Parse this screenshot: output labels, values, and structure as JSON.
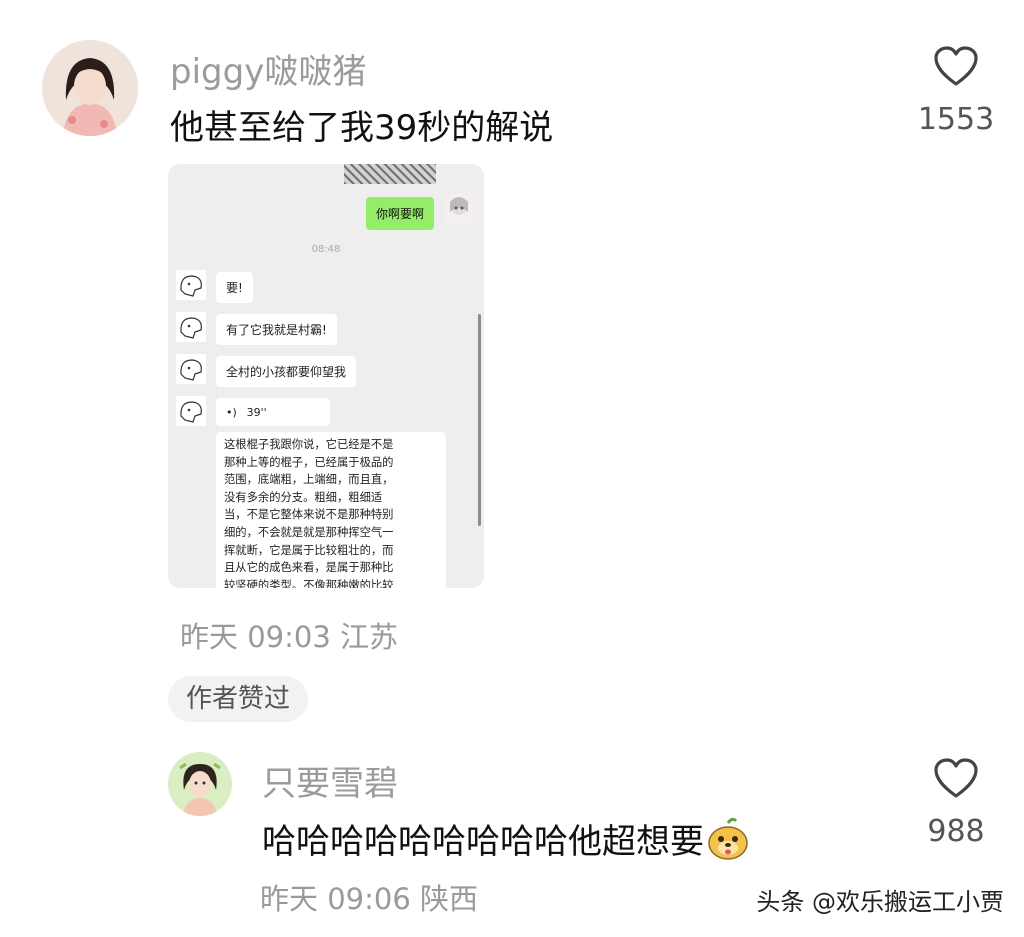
{
  "comments": [
    {
      "username": "piggy啵啵猪",
      "text": "他甚至给了我39秒的解说",
      "likes": "1553",
      "time_location": "昨天 09:03 江苏",
      "badge": "作者赞过",
      "attachment": {
        "sent_message": "你啊要啊",
        "chat_time": "08:48",
        "received_messages": [
          "要!",
          "有了它我就是村霸!",
          "全村的小孩都要仰望我"
        ],
        "voice_duration": "39''",
        "voice_icon": "voice-wave-icon",
        "transcript_lines": [
          "这根棍子我跟你说，它已经是不是",
          "那种上等的棍子，已经属于极品的",
          "范围，底端粗，上端细，而且直，",
          "没有多余的分支。粗细，粗细适",
          "当，不是它整体来说不是那种特别",
          "细的，不会就是就是那种挥空气一",
          "挥就断，它是属于比较粗壮的，而",
          "且从它的成色来看，是属于那种比",
          "较坚硬的类型。不像那种嫩的比较"
        ]
      }
    },
    {
      "username": "只要雪碧",
      "text": "哈哈哈哈哈哈哈哈哈他超想要",
      "emoji": "doge-emoji",
      "likes": "988",
      "time_location": "昨天 09:06 陕西"
    }
  ],
  "watermark": "头条 @欢乐搬运工小贾",
  "icons": {
    "like": "heart-outline-icon"
  },
  "colors": {
    "sent_bubble": "#95ec69",
    "muted_text": "#9a9a9a"
  }
}
